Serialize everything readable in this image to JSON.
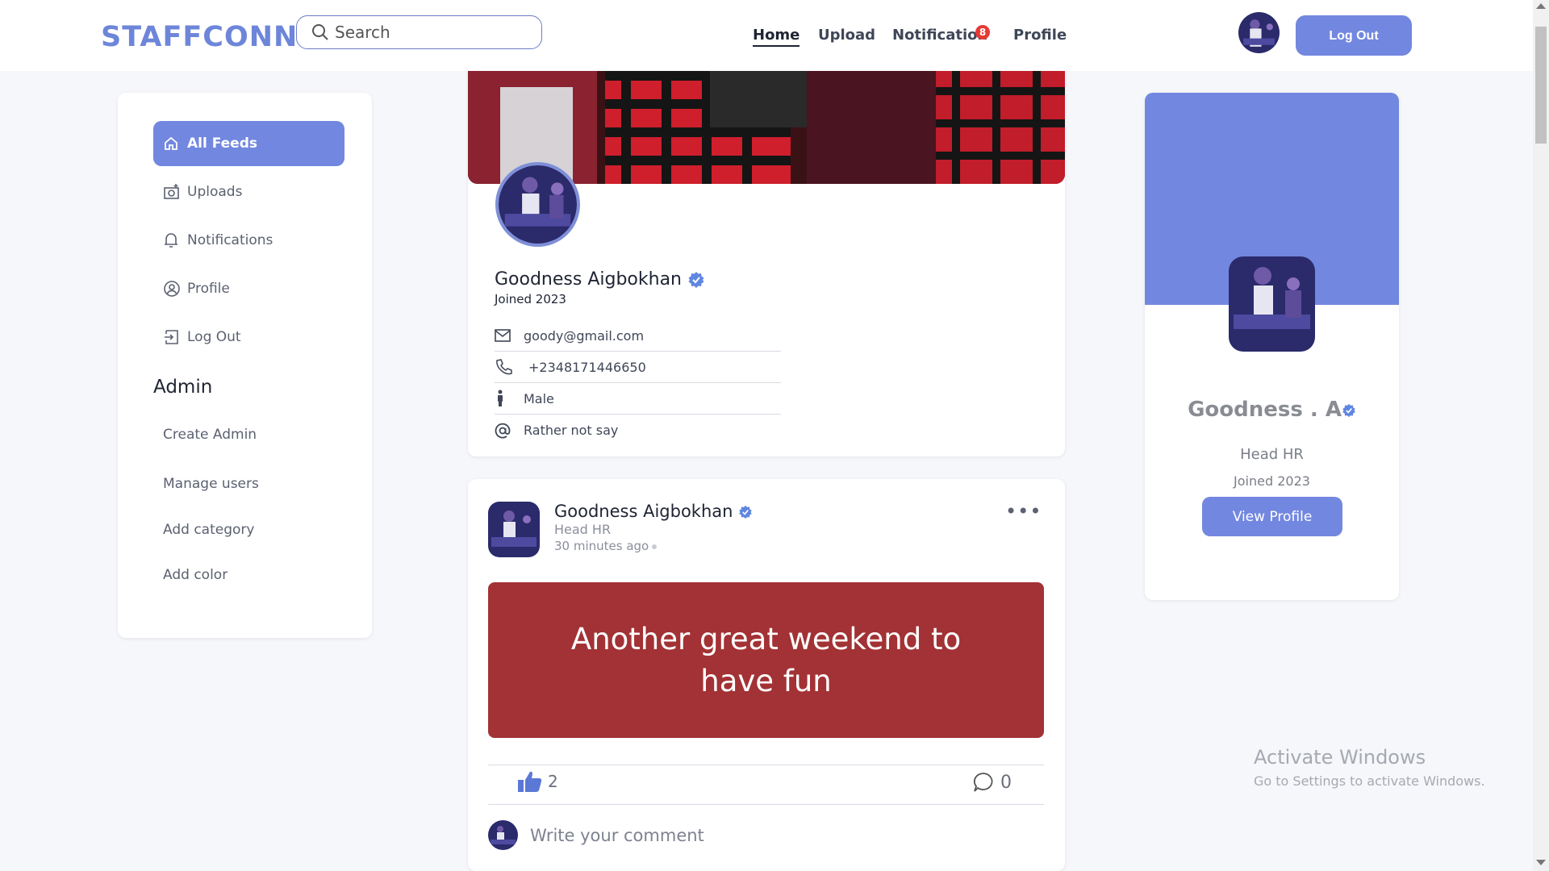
{
  "header": {
    "logo": "STAFFCONN",
    "search_placeholder": "Search",
    "nav": {
      "home": "Home",
      "upload": "Upload",
      "notification": "Notification",
      "notification_count": "8",
      "profile": "Profile"
    },
    "logout_label": "Log Out"
  },
  "sidebar": {
    "items": [
      {
        "label": "All Feeds",
        "icon": "home-icon"
      },
      {
        "label": "Uploads",
        "icon": "camera-add-icon"
      },
      {
        "label": "Notifications",
        "icon": "bell-icon"
      },
      {
        "label": "Profile",
        "icon": "user-circle-icon"
      },
      {
        "label": "Log Out",
        "icon": "logout-icon"
      }
    ],
    "admin_title": "Admin",
    "admin_items": [
      "Create Admin",
      "Manage users",
      "Add category",
      "Add color"
    ]
  },
  "profile": {
    "name": "Goodness Aigbokhan",
    "joined": "Joined 2023",
    "email": "goody@gmail.com",
    "phone": "+2348171446650",
    "gender": "Male",
    "pronoun": "Rather not say"
  },
  "post": {
    "author": "Goodness Aigbokhan",
    "role": "Head HR",
    "time": "30 minutes ago",
    "text": "Another great weekend to have fun",
    "body_color": "#a23235",
    "likes": "2",
    "comments": "0",
    "comment_placeholder": "Write your comment"
  },
  "side_profile": {
    "name": "Goodness . A",
    "role": "Head HR",
    "joined": "Joined  2023",
    "view_label": "View Profile"
  },
  "watermark": {
    "title": "Activate Windows",
    "subtitle": "Go to Settings to activate Windows."
  },
  "colors": {
    "accent": "#7287df",
    "logo": "#6d86d9",
    "badge": "#e53935"
  }
}
